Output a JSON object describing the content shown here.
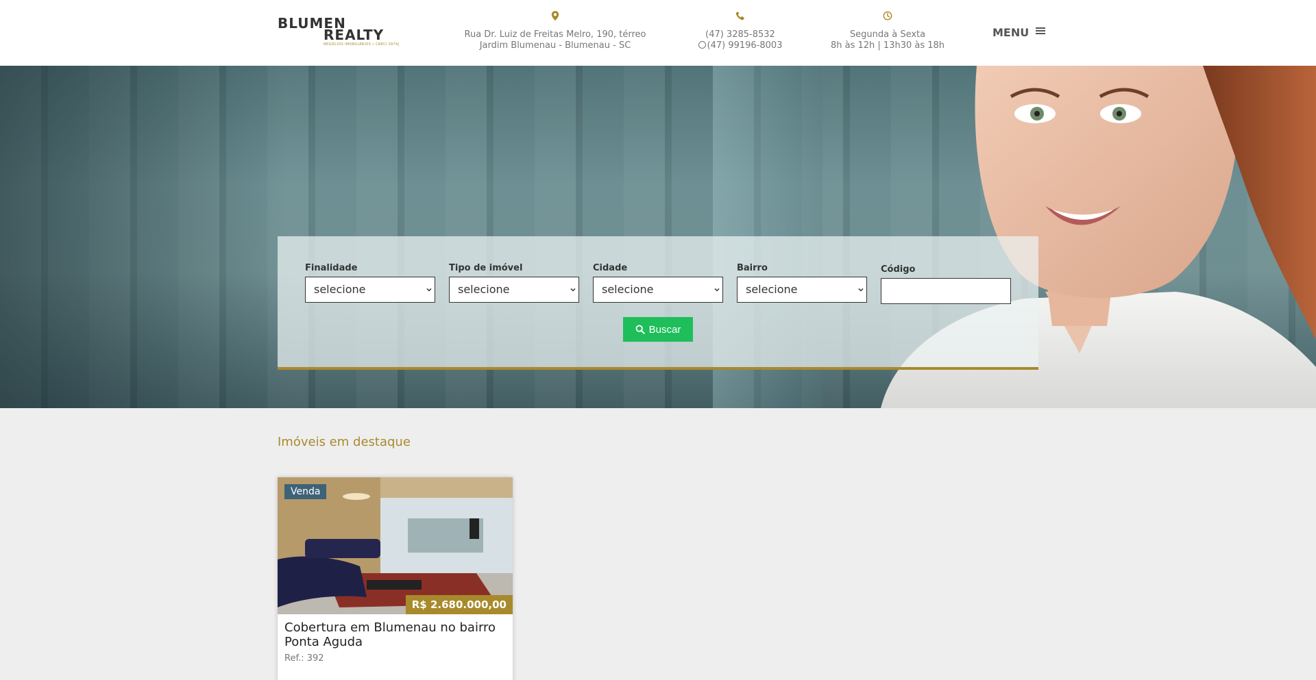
{
  "header": {
    "logo": {
      "line1": "BLUMEN",
      "line2": "REALTY",
      "tagline": "NEGÓCIOS IMOBILIÁRIOS • CRECI 3974J"
    },
    "address": {
      "line1": "Rua Dr. Luiz de Freitas Melro, 190, térreo",
      "line2": "Jardim Blumenau - Blumenau - SC"
    },
    "phone": {
      "line1": "(47) 3285-8532",
      "line2": "(47) 99196-8003"
    },
    "hours": {
      "line1": "Segunda à Sexta",
      "line2": "8h às 12h | 13h30 às 18h"
    },
    "menu_label": "MENU"
  },
  "search": {
    "fields": [
      {
        "label": "Finalidade",
        "value": "selecione"
      },
      {
        "label": "Tipo de imóvel",
        "value": "selecione"
      },
      {
        "label": "Cidade",
        "value": "selecione"
      },
      {
        "label": "Bairro",
        "value": "selecione"
      }
    ],
    "code_label": "Código",
    "code_value": "",
    "button_label": "Buscar"
  },
  "featured": {
    "title": "Imóveis em destaque",
    "cards": [
      {
        "badge": "Venda",
        "price": "R$ 2.680.000,00",
        "title": "Cobertura em Blumenau no bairro Ponta Aguda",
        "ref": "Ref.: 392"
      }
    ]
  },
  "colors": {
    "gold": "#a88a2c",
    "green": "#1ebe5a",
    "badge_blue": "#3e6278"
  },
  "icons": [
    "map-marker-icon",
    "phone-icon",
    "whatsapp-icon",
    "clock-icon",
    "hamburger-icon",
    "search-icon",
    "select-arrow-icon"
  ]
}
